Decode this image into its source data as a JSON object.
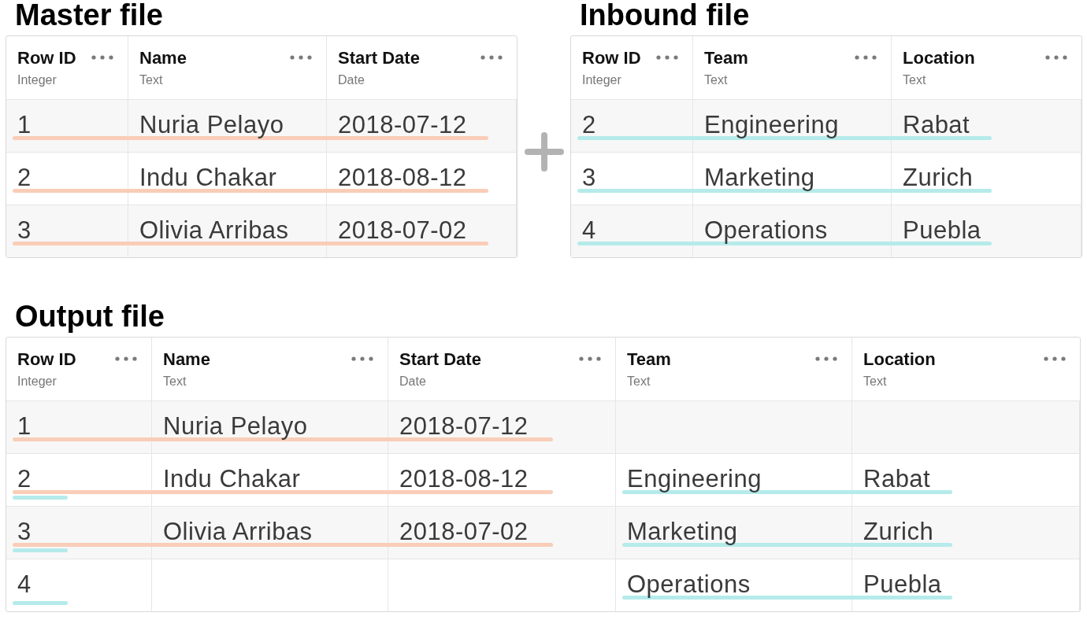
{
  "sections": [
    {
      "title": "Master file",
      "columns": [
        {
          "name": "Row ID",
          "type": "Integer"
        },
        {
          "name": "Name",
          "type": "Text"
        },
        {
          "name": "Start Date",
          "type": "Date"
        }
      ],
      "rows": [
        {
          "cells": [
            "1",
            "Nuria Pelayo",
            "2018-07-12"
          ],
          "marks": [
            {
              "kind": "master",
              "color": "#f9cdb8"
            }
          ]
        },
        {
          "cells": [
            "2",
            "Indu Chakar",
            "2018-08-12"
          ],
          "marks": [
            {
              "kind": "master",
              "color": "#f9cdb8"
            }
          ]
        },
        {
          "cells": [
            "3",
            "Olivia Arribas",
            "2018-07-02"
          ],
          "marks": [
            {
              "kind": "master",
              "color": "#f9cdb8"
            }
          ]
        }
      ]
    },
    {
      "title": "Inbound file",
      "columns": [
        {
          "name": "Row ID",
          "type": "Integer"
        },
        {
          "name": "Team",
          "type": "Text"
        },
        {
          "name": "Location",
          "type": "Text"
        }
      ],
      "rows": [
        {
          "cells": [
            "2",
            "Engineering",
            "Rabat"
          ],
          "marks": [
            {
              "kind": "inbound",
              "color": "#b5ebea"
            }
          ]
        },
        {
          "cells": [
            "3",
            "Marketing",
            "Zurich"
          ],
          "marks": [
            {
              "kind": "inbound",
              "color": "#b5ebea"
            }
          ]
        },
        {
          "cells": [
            "4",
            "Operations",
            "Puebla"
          ],
          "marks": [
            {
              "kind": "inbound",
              "color": "#b5ebea"
            }
          ]
        }
      ]
    },
    {
      "title": "Output file",
      "columns": [
        {
          "name": "Row ID",
          "type": "Integer"
        },
        {
          "name": "Name",
          "type": "Text"
        },
        {
          "name": "Start Date",
          "type": "Date"
        },
        {
          "name": "Team",
          "type": "Text"
        },
        {
          "name": "Location",
          "type": "Text"
        }
      ],
      "rows": [
        {
          "cells": [
            "1",
            "Nuria Pelayo",
            "2018-07-12",
            null,
            null
          ],
          "marks": [
            {
              "kind": "master",
              "color": "#f9cdb8"
            }
          ]
        },
        {
          "cells": [
            "2",
            "Indu Chakar",
            "2018-08-12",
            "Engineering",
            "Rabat"
          ],
          "marks": [
            {
              "kind": "master",
              "color": "#f9cdb8"
            },
            {
              "kind": "stub",
              "color": "#b5ebea"
            },
            {
              "kind": "inbound",
              "color": "#b5ebea"
            }
          ]
        },
        {
          "cells": [
            "3",
            "Olivia Arribas",
            "2018-07-02",
            "Marketing",
            "Zurich"
          ],
          "marks": [
            {
              "kind": "master",
              "color": "#f9cdb8"
            },
            {
              "kind": "stub",
              "color": "#b5ebea"
            },
            {
              "kind": "inbound",
              "color": "#b5ebea"
            }
          ]
        },
        {
          "cells": [
            "4",
            null,
            null,
            "Operations",
            "Puebla"
          ],
          "marks": [
            {
              "kind": "stub",
              "color": "#b5ebea"
            },
            {
              "kind": "inbound",
              "color": "#b5ebea"
            }
          ]
        }
      ]
    }
  ]
}
